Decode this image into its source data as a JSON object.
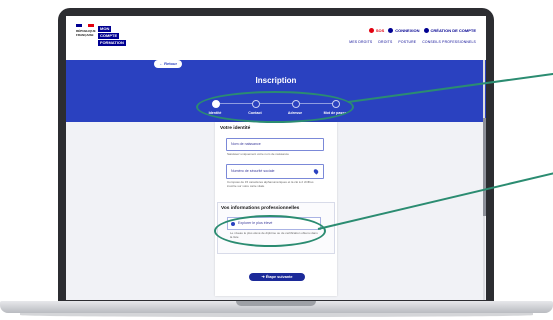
{
  "header": {
    "republic_text": "RÉPUBLIQUE\nFRANÇAISE",
    "brand_lines": [
      "MON",
      "COMPTE",
      "FORMATION"
    ],
    "top_links": [
      "SOS",
      "CONNEXION",
      "CRÉATION DE COMPTE"
    ],
    "nav_items": [
      "MES DROITS",
      "DROITS",
      "POSTURE",
      "CONSEILS PROFESSIONNELS"
    ]
  },
  "banner": {
    "back_label": "Retour",
    "title": "Inscription",
    "steps": [
      "Identité",
      "Contact",
      "Adresse",
      "Mot de passe"
    ]
  },
  "form": {
    "identity_title": "Votre identité",
    "field1_label": "Nom de naissance",
    "field1_hint": "Saisissez uniquement votre nom de naissance",
    "field2_label": "Numéro de sécurité sociale",
    "field2_hint": "Composé de 15 caractères alphanumériques et la clé à 2 chiffres inscrite sur votre carte vitale",
    "pro_title": "Vos informations professionnelles",
    "pro_choice": "Explorer le plus élevé",
    "pro_hint": "Le niveau le plus élevé de diplôme ou de certification obtenu dans la liste",
    "next_label": "Étape suivante"
  },
  "colors": {
    "primary": "#2a41c0",
    "annotation": "#2b8c71"
  }
}
